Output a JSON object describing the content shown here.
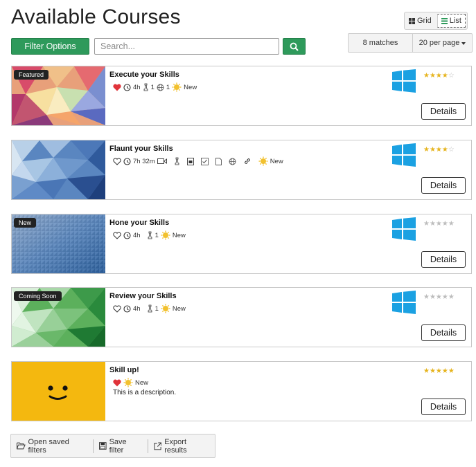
{
  "header": {
    "title": "Available Courses",
    "view_grid": "Grid",
    "view_list": "List",
    "active_view": "List"
  },
  "toolbar": {
    "filter_label": "Filter Options",
    "search_placeholder": "Search...",
    "search_value": "",
    "matches": "8 matches",
    "per_page": "20 per page"
  },
  "colors": {
    "accent": "#2e9a5b",
    "windows": "#1ba1e2",
    "star": "#e6b41e",
    "heart": "#e0333a"
  },
  "courses": [
    {
      "title": "Execute your Skills",
      "badge": "Featured",
      "favorite": true,
      "duration": "4h",
      "count1": "1",
      "count2": "1",
      "status": "New",
      "rating": 4,
      "details": "Details"
    },
    {
      "title": "Flaunt your Skills",
      "badge": "",
      "favorite": false,
      "duration": "7h 32m",
      "status": "New",
      "rating": 4,
      "details": "Details"
    },
    {
      "title": "Hone your Skills",
      "badge": "New",
      "favorite": false,
      "duration": "4h",
      "count1": "1",
      "status": "New",
      "rating": 0,
      "details": "Details"
    },
    {
      "title": "Review your Skills",
      "badge": "Coming Soon",
      "favorite": false,
      "duration": "4h",
      "count1": "1",
      "status": "New",
      "rating": 0,
      "details": "Details"
    },
    {
      "title": "Skill up!",
      "badge": "",
      "favorite": true,
      "status": "New",
      "description": "This is a description.",
      "rating": 5,
      "details": "Details"
    }
  ],
  "footer": {
    "open_filters": "Open saved filters",
    "save_filter": "Save filter",
    "export": "Export results"
  }
}
